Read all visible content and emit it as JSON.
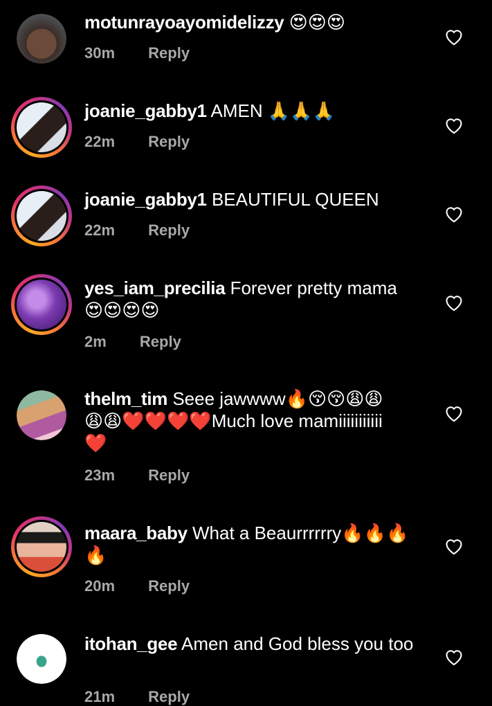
{
  "comments": [
    {
      "username": "motunrayoayomidelizzy",
      "text": "",
      "emoji": "😍😍😍",
      "time": "30m",
      "reply": "Reply"
    },
    {
      "username": "joanie_gabby1",
      "text": "AMEN",
      "emoji": "🙏🙏🙏",
      "time": "22m",
      "reply": "Reply"
    },
    {
      "username": "joanie_gabby1",
      "text": "BEAUTIFUL QUEEN",
      "time": "22m",
      "reply": "Reply"
    },
    {
      "username": "yes_iam_precilia",
      "text": "Forever pretty mama",
      "emoji": "😍😍😍😍",
      "time": "2m",
      "reply": "Reply"
    },
    {
      "username": "thelm_tim",
      "text": "Seee jawwww",
      "emoji_line1": "🔥😚😚😩😩",
      "emoji_line2": "😩😩❤️❤️❤️❤️",
      "text2": "Much love mamiiiiiiiiiii",
      "emoji_line3": "❤️",
      "time": "23m",
      "reply": "Reply"
    },
    {
      "username": "maara_baby",
      "text": "What a Beaurrrrrry",
      "emoji": "🔥🔥🔥",
      "emoji_line2": "🔥",
      "time": "20m",
      "reply": "Reply"
    },
    {
      "username": "itohan_gee",
      "text": "Amen  and God bless you too",
      "time": "21m",
      "reply": "Reply"
    }
  ],
  "icons": {
    "like": "heart-outline-icon"
  },
  "colors": {
    "background": "#000000",
    "meta": "#a8a8a8",
    "story_ring": "#e1306c"
  }
}
